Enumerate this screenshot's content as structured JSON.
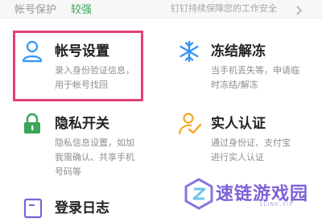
{
  "top": {
    "label": "帐号保护",
    "level": "较强",
    "tip": "钉钉持续保障您的工作安全"
  },
  "items": [
    {
      "title": "帐号设置",
      "desc": "录入身份验证信息，用于帐号找回",
      "icon": "user-icon"
    },
    {
      "title": "冻结解冻",
      "desc": "当手机丢失等，申请临时冻结/解冻",
      "icon": "snowflake-icon"
    },
    {
      "title": "隐私开关",
      "desc": "隐私信息设置，如加我需确认、共享手机号码等",
      "icon": "lock-icon"
    },
    {
      "title": "实人认证",
      "desc": "通过身份证、支付宝进行实人认证",
      "icon": "person-check-icon"
    },
    {
      "title": "登录日志",
      "desc": "",
      "icon": "log-icon"
    }
  ],
  "watermark": {
    "text": "速链游戏园",
    "url": "SLINK.VIP"
  },
  "colors": {
    "accent": "#3296fa",
    "highlight": "#e3407a",
    "level": "#3aa65a",
    "verify": "#f5a623"
  }
}
